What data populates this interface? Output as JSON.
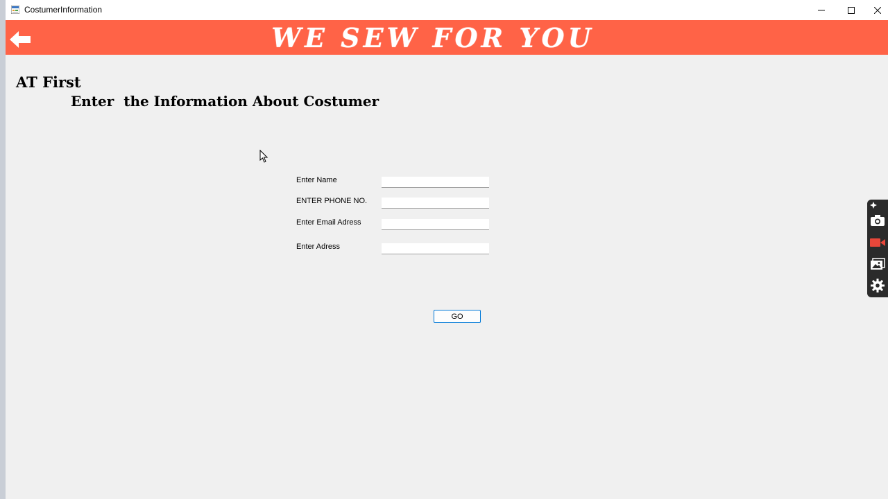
{
  "window": {
    "title": "CostumerInformation",
    "controls": {
      "minimize_icon": "minimize-icon",
      "maximize_icon": "maximize-icon",
      "close_icon": "close-icon"
    }
  },
  "banner": {
    "title": "WE SEW FOR YOU",
    "color": "#ff6347",
    "back_icon": "back-arrow-icon"
  },
  "headings": {
    "line1": "AT First",
    "line2": "Enter  the Information About Costumer"
  },
  "form": {
    "fields": [
      {
        "label": "Enter Name",
        "value": ""
      },
      {
        "label": "ENTER PHONE NO.",
        "value": ""
      },
      {
        "label": "Enter Email Adress",
        "value": ""
      },
      {
        "label": "Enter Adress",
        "value": ""
      }
    ],
    "submit_label": "GO"
  },
  "side_toolbar": {
    "tools": [
      "pin-icon",
      "camera-icon",
      "video-record-icon",
      "gallery-icon",
      "settings-gear-icon"
    ],
    "accent": "#e8473a"
  }
}
